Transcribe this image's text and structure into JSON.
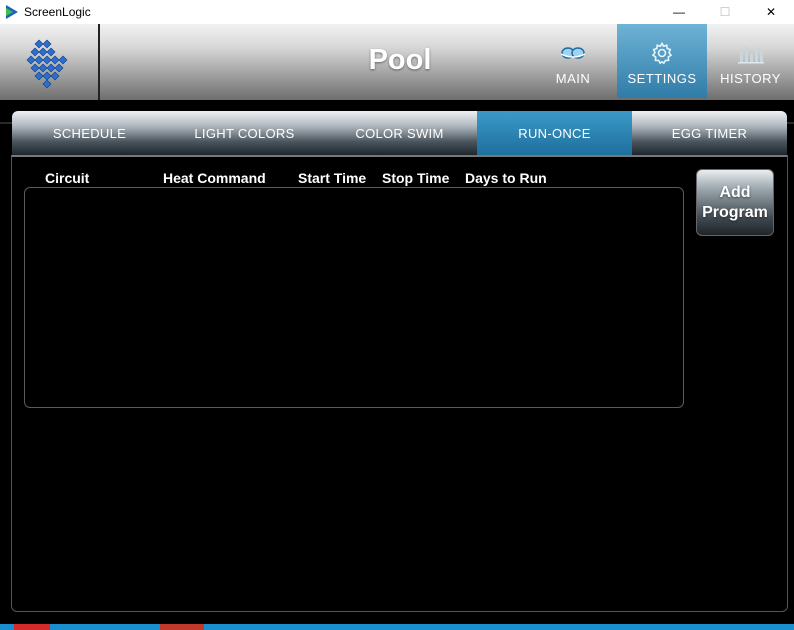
{
  "window": {
    "title": "ScreenLogic",
    "minimize_glyph": "—",
    "maximize_glyph": "☐",
    "close_glyph": "✕"
  },
  "header": {
    "title": "Pool",
    "nav": [
      {
        "label": "MAIN",
        "icon": "pool-goggles-icon"
      },
      {
        "label": "SETTINGS",
        "icon": "gear-icon",
        "active": true
      },
      {
        "label": "HISTORY",
        "icon": "bar-chart-icon"
      }
    ]
  },
  "tabs": [
    {
      "label": "SCHEDULE"
    },
    {
      "label": "LIGHT COLORS"
    },
    {
      "label": "COLOR SWIM"
    },
    {
      "label": "RUN-ONCE",
      "active": true
    },
    {
      "label": "EGG TIMER"
    }
  ],
  "table": {
    "columns": [
      "Circuit",
      "Heat Command",
      "Start Time",
      "Stop Time",
      "Days to Run"
    ],
    "rows": []
  },
  "add_button": {
    "line1": "Add",
    "line2": "Program"
  },
  "colors": {
    "accent": "#2f7ca8",
    "background": "#000000"
  }
}
